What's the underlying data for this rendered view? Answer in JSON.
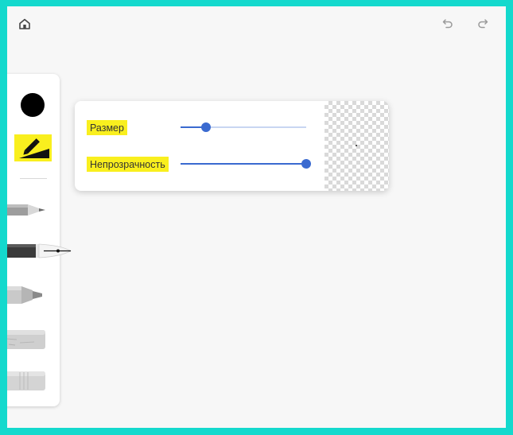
{
  "header": {
    "home_icon": "home-icon",
    "undo_icon": "undo-icon",
    "redo_icon": "redo-icon"
  },
  "toolbar": {
    "selected_color": "#000000",
    "highlight_color": "#f9ef1e",
    "tools": [
      "pencil",
      "pen",
      "marker",
      "chalk",
      "eraser"
    ],
    "selected_tool": "pen"
  },
  "pen_settings": {
    "size_label": "Размер",
    "size_value": 0.2,
    "opacity_label": "Непрозрачность",
    "opacity_value": 1.0,
    "accent_color": "#3a6ad0"
  }
}
